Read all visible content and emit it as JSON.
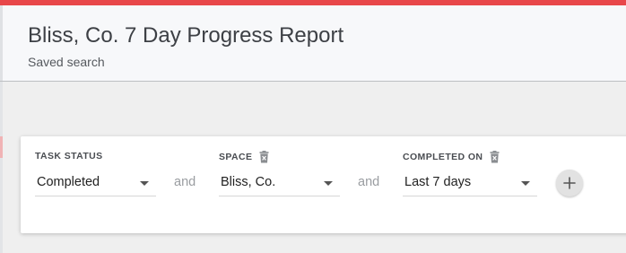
{
  "header": {
    "title": "Bliss, Co. 7 Day Progress Report",
    "subtitle": "Saved search"
  },
  "filters": [
    {
      "label": "TASK STATUS",
      "value": "Completed",
      "removable": false
    },
    {
      "label": "SPACE",
      "value": "Bliss, Co.",
      "removable": true,
      "remove_icon": "trash-icon"
    },
    {
      "label": "COMPLETED ON",
      "value": "Last 7 days",
      "removable": true,
      "remove_icon": "trash-icon"
    }
  ],
  "connectors": [
    "and",
    "and"
  ],
  "add_filter_icon": "plus-icon",
  "colors": {
    "accent_bar": "#e8474a",
    "header_bg": "#f7f8fa",
    "page_bg": "#efefef",
    "card_bg": "#ffffff",
    "connector_text": "#9a9da1"
  }
}
